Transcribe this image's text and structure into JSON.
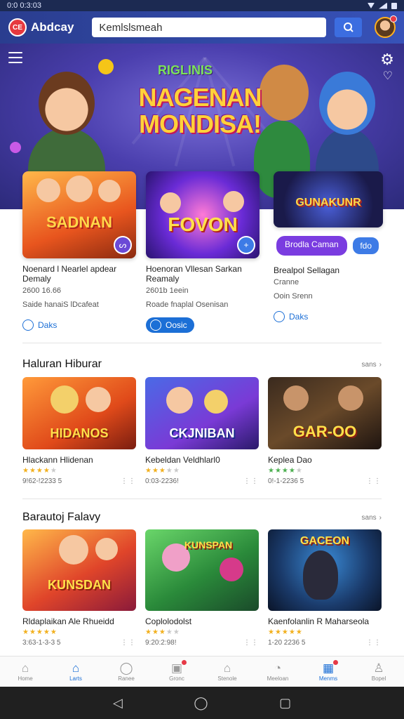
{
  "status_bar": {
    "time": "0:0  0:3:03"
  },
  "app_bar": {
    "brand": "Abdcay",
    "search_value": "Kemlslsmeah",
    "colors": {
      "bar": "#2a3d8f",
      "accent": "#3c6de0"
    }
  },
  "hero": {
    "subtitle": "RIGLINIS",
    "title_line1": "NAGENAN",
    "title_line2": "MONDISA!"
  },
  "featured": [
    {
      "art": "SADNAN",
      "title": "Noenard l Nearlel apdear Demaly",
      "meta": "2600 16.66",
      "desc": "Saide hanaiS lDcafeat",
      "action": "Daks",
      "action_style": "outline",
      "badge": "ᔕ"
    },
    {
      "art": "FOVON",
      "title": "Hoenoran Vllesan Sarkan Reamaly",
      "meta": "2601b 1eein",
      "desc": "Roade fnaplal Osenisan",
      "action": "Oosic",
      "action_style": "solid",
      "badge": "+"
    },
    {
      "art": "GUNAKUNR",
      "title": "Brealpol Sellagan",
      "meta": "Cranne",
      "desc": "Ooin Srenn",
      "action": "Daks",
      "action_style": "outline",
      "pill": "Brodla Caman",
      "pill2": "fdo"
    }
  ],
  "sections": [
    {
      "title": "Haluran Hiburar",
      "see_all": "sans",
      "games": [
        {
          "art": "HIDANOS",
          "name": "Hlackann Hlidenan",
          "stars": 4,
          "meta": "9!62-!2233 5",
          "more": "⋮⋮"
        },
        {
          "art": "CKJNIBAN",
          "name": "Kebeldan Veldhlarl0",
          "stars": 3,
          "meta": "0:03-2236!",
          "more": "⋮⋮"
        },
        {
          "art": "GAR-OO",
          "name": "Keplea Dao",
          "stars": 4,
          "meta": "0!-1-2236 5",
          "more": "⋮⋮"
        }
      ]
    },
    {
      "title": "Barautoj Falavy",
      "see_all": "sans",
      "games": [
        {
          "art": "KUNSDAN",
          "name": "Rldaplaikan Ale Rhueidd",
          "stars": 5,
          "meta": "3:63-1-3-3 5",
          "more": "⋮⋮"
        },
        {
          "art": "KUNSPAN",
          "name": "Coplolodolst",
          "stars": 3,
          "meta": "9:20:2:98!",
          "more": "⋮⋮"
        },
        {
          "art": "GACEON",
          "name": "Kaenfolanlin R Maharseola",
          "stars": 5,
          "meta": "1-20 2236 5",
          "more": "⋮⋮"
        }
      ]
    }
  ],
  "bottom_nav": [
    {
      "label": "Home",
      "icon": "home-icon",
      "glyph": "⌂"
    },
    {
      "label": "Larts",
      "icon": "house-filled-icon",
      "glyph": "⌂",
      "active": true
    },
    {
      "label": "Ranee",
      "icon": "chat-icon",
      "glyph": "◯"
    },
    {
      "label": "Gronc",
      "icon": "gift-icon",
      "glyph": "▣",
      "dot": true
    },
    {
      "label": "Stenole",
      "icon": "store-icon",
      "glyph": "⌂"
    },
    {
      "label": "Meeloan",
      "icon": "clock-icon",
      "glyph": "◔"
    },
    {
      "label": "Menms",
      "icon": "grid-icon",
      "glyph": "▦",
      "active": true,
      "dot": true
    },
    {
      "label": "Bopel",
      "icon": "profile-icon",
      "glyph": "♙"
    }
  ],
  "system_nav": {
    "back": "◁",
    "home": "◯",
    "recents": "▢"
  }
}
